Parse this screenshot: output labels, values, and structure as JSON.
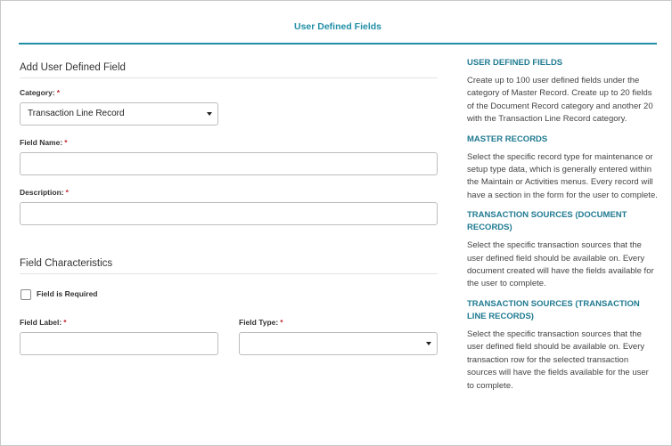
{
  "header": {
    "title": "User Defined Fields"
  },
  "add_section": {
    "title": "Add User Defined Field",
    "category": {
      "label": "Category:",
      "value": "Transaction Line Record",
      "required": "*"
    },
    "field_name": {
      "label": "Field Name:",
      "value": "",
      "required": "*"
    },
    "description": {
      "label": "Description:",
      "value": "",
      "required": "*"
    }
  },
  "characteristics": {
    "title": "Field Characteristics",
    "required_checkbox": {
      "label": "Field is Required",
      "checked": false
    },
    "field_label": {
      "label": "Field Label:",
      "value": "",
      "required": "*"
    },
    "field_type": {
      "label": "Field Type:",
      "value": "",
      "required": "*"
    }
  },
  "help": [
    {
      "heading": "USER DEFINED FIELDS",
      "text": "Create up to 100 user defined fields under the category of Master Record. Create up to 20 fields of the Document Record category and another 20 with the Transaction Line Record category."
    },
    {
      "heading": "MASTER RECORDS",
      "text": "Select the specific record type for maintenance or setup type data, which is generally entered within the Maintain or Activities menus. Every record will have a section in the form for the user to complete."
    },
    {
      "heading": "TRANSACTION SOURCES (DOCUMENT RECORDS)",
      "text": "Select the specific transaction sources that the user defined field should be available on. Every document created will have the fields available for the user to complete."
    },
    {
      "heading": "TRANSACTION SOURCES (TRANSACTION LINE RECORDS)",
      "text": "Select the specific transaction sources that the user defined field should be available on. Every transaction row for the selected transaction sources will have the fields available for the user to complete."
    }
  ],
  "colors": {
    "accent": "#1f8fa6",
    "help_heading": "#1f7a91",
    "required": "#c0282e"
  }
}
